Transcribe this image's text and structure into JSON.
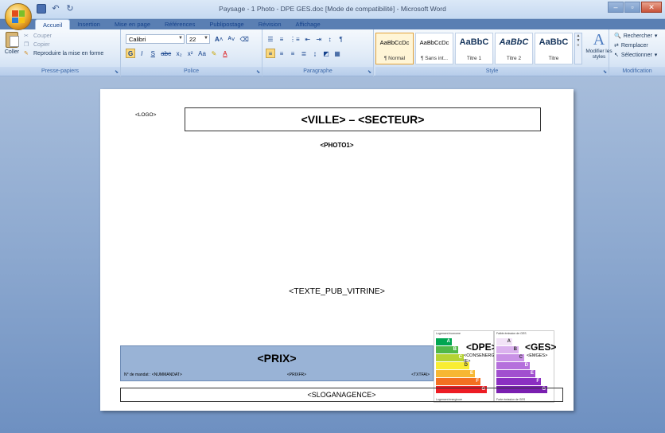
{
  "window": {
    "title": "Paysage - 1 Photo - DPE GES.doc [Mode de compatibilité] - Microsoft Word"
  },
  "tabs": [
    {
      "label": "Accueil",
      "active": true
    },
    {
      "label": "Insertion"
    },
    {
      "label": "Mise en page"
    },
    {
      "label": "Références"
    },
    {
      "label": "Publipostage"
    },
    {
      "label": "Révision"
    },
    {
      "label": "Affichage"
    }
  ],
  "ribbon": {
    "clipboard": {
      "paste": "Coller",
      "cut": "Couper",
      "copy": "Copier",
      "format_painter": "Reproduire la mise en forme",
      "group_label": "Presse-papiers"
    },
    "font": {
      "font_name": "Calibri",
      "font_size": "22",
      "group_label": "Police"
    },
    "paragraph": {
      "group_label": "Paragraphe"
    },
    "styles": {
      "items": [
        {
          "sample": "AaBbCcDc",
          "name": "¶ Normal",
          "selected": true
        },
        {
          "sample": "AaBbCcDc",
          "name": "¶ Sans int..."
        },
        {
          "sample": "AaBbC",
          "name": "Titre 1"
        },
        {
          "sample": "AaBbC",
          "name": "Titre 2"
        },
        {
          "sample": "AaBbC",
          "name": "Titre"
        }
      ],
      "modify_label": "Modifier les styles",
      "group_label": "Style"
    },
    "editing": {
      "find": "Rechercher",
      "replace": "Remplacer",
      "select": "Sélectionner",
      "group_label": "Modification"
    }
  },
  "document": {
    "logo": "<LOGO>",
    "ville_secteur": "<VILLE> – <SECTEUR>",
    "photo": "<PHOTO1>",
    "texte_pub": "<TEXTE_PUB_VITRINE>",
    "prix_title": "<PRIX>",
    "mandat": "N° de mandat : <NUMMANDAT>",
    "prixfr": "<PRIXFR>",
    "txtfai": "<TXTFAI>",
    "slogan": "<SLOGANAGENCE>",
    "dpe": {
      "label": "<DPE>",
      "sub": "<CONSENERG IE>",
      "top_caption": "Logement économe",
      "bottom_caption": "Logement énergivore"
    },
    "ges": {
      "label": "<GES>",
      "sub": "<EMGES>",
      "top_caption": "Faible émission de GES",
      "bottom_caption": "Forte émission de GES"
    }
  },
  "colors": {
    "dpe": [
      "#00a651",
      "#50b848",
      "#b5d334",
      "#f9ed32",
      "#f7b733",
      "#f37021",
      "#ed1c24"
    ],
    "ges": [
      "#f2e3f7",
      "#dbb2ee",
      "#c991e6",
      "#b56fdc",
      "#a14fcf",
      "#8b2fc2",
      "#7a1fb0"
    ]
  }
}
